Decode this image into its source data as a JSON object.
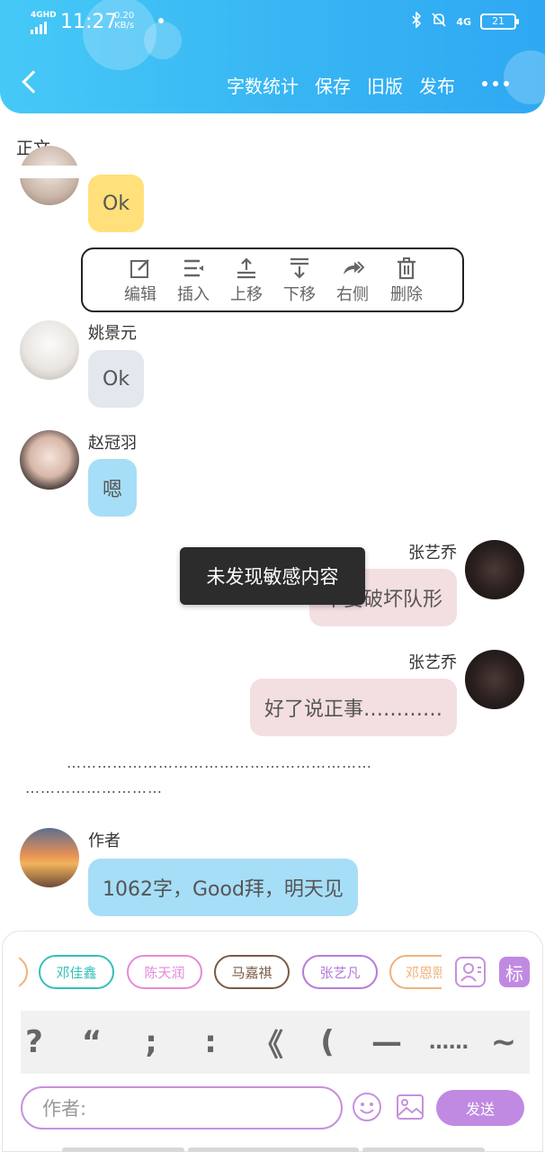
{
  "status_bar": {
    "network": "4GHD",
    "time": "11:27",
    "speed_value": "0.20",
    "speed_unit": "KB/s",
    "network_right": "4G",
    "battery": "21"
  },
  "header": {
    "menu": [
      "字数统计",
      "保存",
      "旧版",
      "发布"
    ]
  },
  "section_title": "正文",
  "toolbar": {
    "items": [
      {
        "label": "编辑",
        "icon": "edit-icon"
      },
      {
        "label": "插入",
        "icon": "insert-icon"
      },
      {
        "label": "上移",
        "icon": "move-up-icon"
      },
      {
        "label": "下移",
        "icon": "move-down-icon"
      },
      {
        "label": "右侧",
        "icon": "redo-icon"
      },
      {
        "label": "删除",
        "icon": "trash-icon"
      }
    ]
  },
  "messages": [
    {
      "text": "Ok"
    },
    {
      "name": "姚景元",
      "text": "Ok"
    },
    {
      "name": "赵冠羽",
      "text": "嗯"
    },
    {
      "name": "张艺乔",
      "text": "不要破坏队形"
    },
    {
      "name": "张艺乔",
      "text": "好了说正事…………"
    },
    {
      "name": "作者",
      "text": "1062字，Good拜，明天见"
    }
  ],
  "toast": "未发现敏感内容",
  "ellipsis": {
    "line1": "……………………………………………………",
    "line2": "………………………"
  },
  "chips": [
    "邓佳鑫",
    "陈天润",
    "马嘉祺",
    "张艺凡",
    "邓恩熙"
  ],
  "tag_label": "标",
  "punctuation": [
    "?",
    "“",
    ";",
    ":",
    "《",
    "(",
    "—",
    "……",
    "~"
  ],
  "input": {
    "placeholder": "作者:"
  },
  "send_label": "发送",
  "colors": {
    "header": "#37b5f3",
    "yellow_bubble": "#ffe07a",
    "gray_bubble": "#e2e8ee",
    "blue_bubble": "#a6def7",
    "pink_bubble": "#f3dfe0",
    "send": "#c08ae2"
  }
}
